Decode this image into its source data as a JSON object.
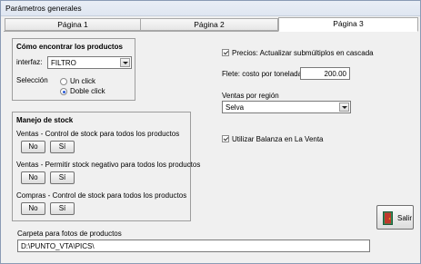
{
  "window": {
    "title": "Parámetros generales"
  },
  "tabs": [
    {
      "label": "Página 1"
    },
    {
      "label": "Página 2"
    },
    {
      "label": "Página 3"
    }
  ],
  "productos": {
    "title": "Cómo encontrar los productos",
    "interfaz_label": "interfaz:",
    "interfaz_value": "FILTRO",
    "seleccion_label": "Selección",
    "options": [
      "Un click",
      "Doble click"
    ],
    "selected": "Doble click"
  },
  "stock": {
    "title": "Manejo de stock",
    "rows": [
      {
        "label": "Ventas - Control de stock para todos los productos",
        "no": "No",
        "si": "Sí"
      },
      {
        "label": "Ventas - Permitir stock negativo para todos los productos",
        "no": "No",
        "si": "Sí"
      },
      {
        "label": "Compras - Control de stock para todos los productos",
        "no": "No",
        "si": "Sí"
      }
    ]
  },
  "right": {
    "precios_label": "Precios: Actualizar submúltiplos en cascada",
    "precios_checked": true,
    "flete_label": "Flete: costo por tonelada",
    "flete_value": "200.00",
    "ventas_region_label": "Ventas por región",
    "ventas_region_value": "Selva",
    "balanza_label": "Utilizar Balanza en La Venta",
    "balanza_checked": true
  },
  "fotos": {
    "label": "Carpeta para fotos de productos",
    "value": "D:\\PUNTO_VTA\\PICS\\"
  },
  "salir_label": "Salir",
  "colors": {
    "radio_dot": "#2a5bd7",
    "exit_door": "#c0392b",
    "exit_frame": "#2e8b57"
  }
}
